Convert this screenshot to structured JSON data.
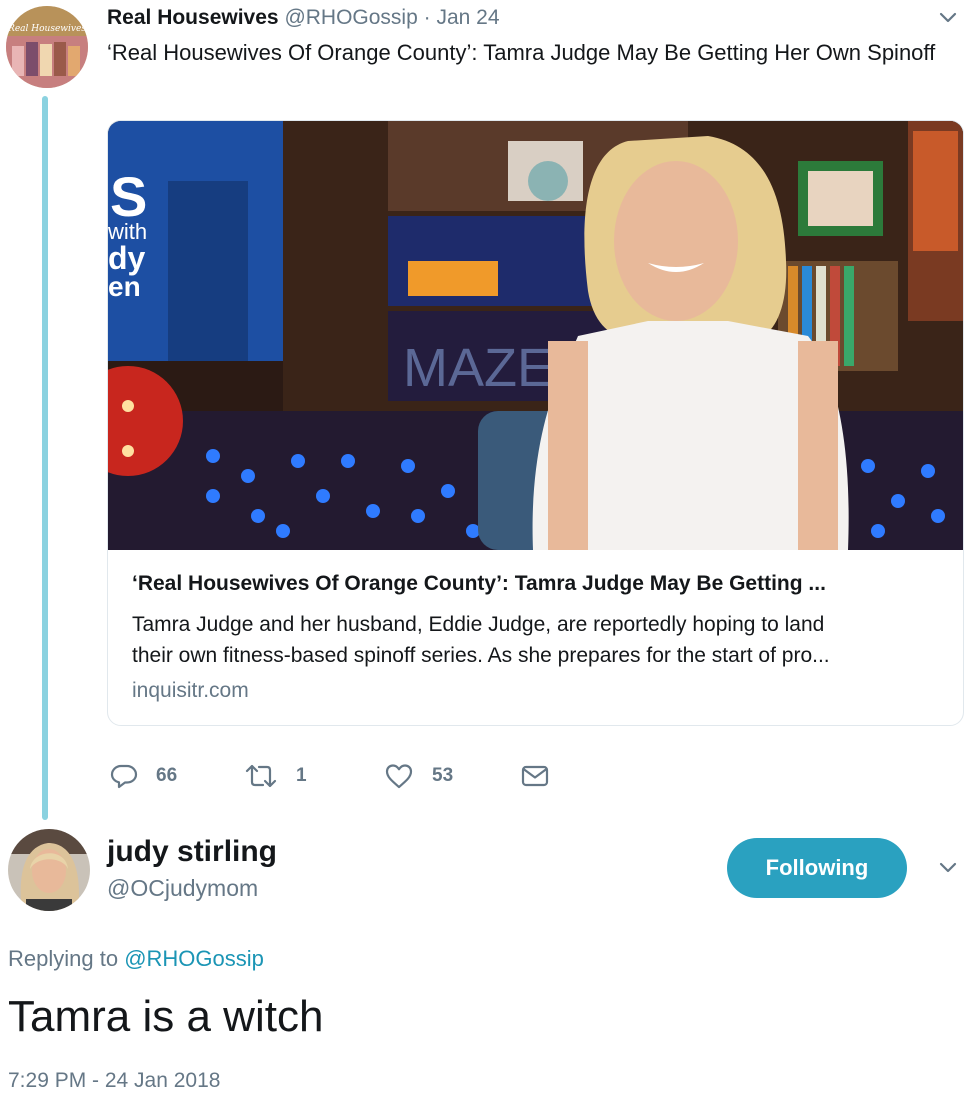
{
  "tweet1": {
    "author_name": "Real Housewives",
    "handle": "@RHOGossip",
    "date": "· Jan 24",
    "text": "‘Real Housewives Of Orange County’: Tamra Judge May Be Getting Her Own Spinoff",
    "card": {
      "title": "‘Real Housewives Of Orange County’: Tamra Judge May Be Getting ...",
      "description_line1": "Tamra Judge and her husband, Eddie Judge, are reportedly hoping to land",
      "description_line2": "their own fitness-based spinoff series. As she prepares for the start of pro...",
      "domain": "inquisitr.com",
      "image_sign_text": "MAZE"
    },
    "actions": {
      "replies": "66",
      "retweets": "1",
      "likes": "53"
    },
    "avatar_banner_text": "Real Housewives"
  },
  "tweet2": {
    "author_name": "judy stirling",
    "handle": "@OCjudymom",
    "follow_label": "Following",
    "replying_prefix": "Replying to",
    "replying_to": "@RHOGossip",
    "text": "Tamra is a witch",
    "timestamp": "7:29 PM - 24 Jan 2018"
  },
  "icons": {
    "reply": "reply-icon",
    "retweet": "retweet-icon",
    "like": "heart-icon",
    "dm": "envelope-icon",
    "more": "chevron-down-icon"
  },
  "colors": {
    "accent": "#2aa1c0",
    "thread_line": "#8bd2e0",
    "muted_text": "#657786",
    "link": "#1b95b5"
  }
}
